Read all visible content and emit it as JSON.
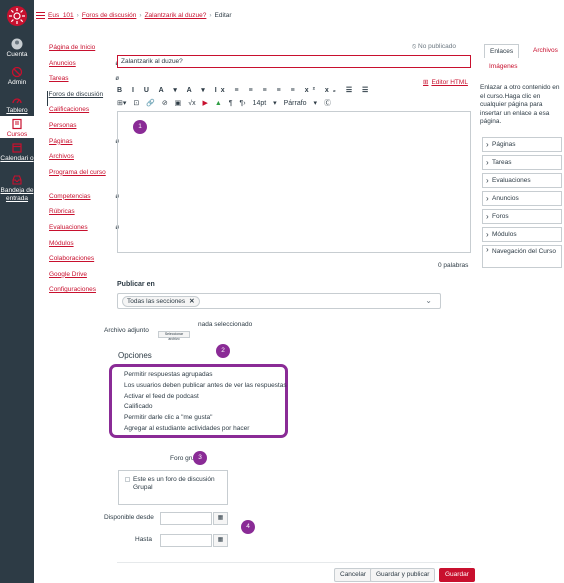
{
  "global_nav": {
    "items": [
      {
        "label": "Cuenta",
        "icon": "avatar-icon"
      },
      {
        "label": "Admin",
        "icon": "admin-icon"
      },
      {
        "label": "Tablero",
        "icon": "dashboard-icon"
      },
      {
        "label": "Cursos",
        "icon": "courses-icon"
      },
      {
        "label": "Calendari o",
        "icon": "calendar-icon"
      },
      {
        "label": "Bandeja de entrada",
        "icon": "inbox-icon"
      }
    ]
  },
  "breadcrumb": {
    "items": [
      "Eus_101",
      "Foros de discusión",
      "Zalantzarik al duzue?",
      "Editar"
    ]
  },
  "course_nav": {
    "items": [
      {
        "label": "Página de Inicio",
        "hidden": false
      },
      {
        "label": "Anuncios",
        "hidden": true
      },
      {
        "label": "Tareas",
        "hidden": true
      },
      {
        "label": "Foros de discusión",
        "hidden": false,
        "active": true
      },
      {
        "label": "Calificaciones",
        "hidden": false
      },
      {
        "label": "Personas",
        "hidden": false
      },
      {
        "label": "Páginas",
        "hidden": true
      },
      {
        "label": "Archivos",
        "hidden": false
      },
      {
        "label": "Programa del curso",
        "hidden": false
      },
      {
        "label": "Competencias",
        "hidden": true
      },
      {
        "label": "Rúbricas",
        "hidden": false
      },
      {
        "label": "Evaluaciones",
        "hidden": true
      },
      {
        "label": "Módulos",
        "hidden": false
      },
      {
        "label": "Colaboraciones",
        "hidden": false
      },
      {
        "label": "Google Drive",
        "hidden": false
      },
      {
        "label": "Configuraciones",
        "hidden": false
      }
    ],
    "hidden_icon": "eye-slash-icon"
  },
  "editor": {
    "publish_status": "No publicado",
    "title_value": "Zalantzarik al duzue?",
    "html_editor_label": "Editor HTML",
    "toolbar_row1": "B I U A ▾ A ▾ Ix ≡ ≡ ≡ ≡ ≡ x² x₂ ☰ ☰",
    "toolbar_row2_font_size": "14pt",
    "toolbar_row2_format": "Párrafo",
    "word_count": "0 palabras"
  },
  "publish_in": {
    "label": "Publicar en",
    "chip": "Todas las secciones"
  },
  "attachment": {
    "label": "Archivo adjunto",
    "button": "Seleccionar archivo",
    "status": "nada seleccionado"
  },
  "options": {
    "title": "Opciones",
    "items": [
      "Permitir respuestas agrupadas",
      "Los usuarios deben publicar antes de ver las respuestas",
      "Activar el feed de podcast",
      "Calificado",
      "Permitir darle clic a \"me gusta\"",
      "Agregar al estudiante actividades por hacer"
    ]
  },
  "group": {
    "label": "Foro grupal",
    "checkbox_label": "Este es un foro de discusión Grupal"
  },
  "dates": {
    "available_from": "Disponible desde",
    "until": "Hasta"
  },
  "footer": {
    "cancel": "Cancelar",
    "save_publish": "Guardar y publicar",
    "save": "Guardar"
  },
  "right_panel": {
    "tabs": [
      "Enlaces",
      "Archivos",
      "Imágenes"
    ],
    "description": "Enlazar a otro contenido en el curso.Haga clic en cualquier página para insertar un enlace a esa página.",
    "items": [
      "Páginas",
      "Tareas",
      "Evaluaciones",
      "Anuncios",
      "Foros",
      "Módulos",
      "Navegación del Curso"
    ]
  },
  "badges": [
    "1",
    "2",
    "3",
    "4"
  ],
  "colors": {
    "brand": "#c8102e",
    "nav_bg": "#2d3b45",
    "annotation": "#8a2b96"
  }
}
